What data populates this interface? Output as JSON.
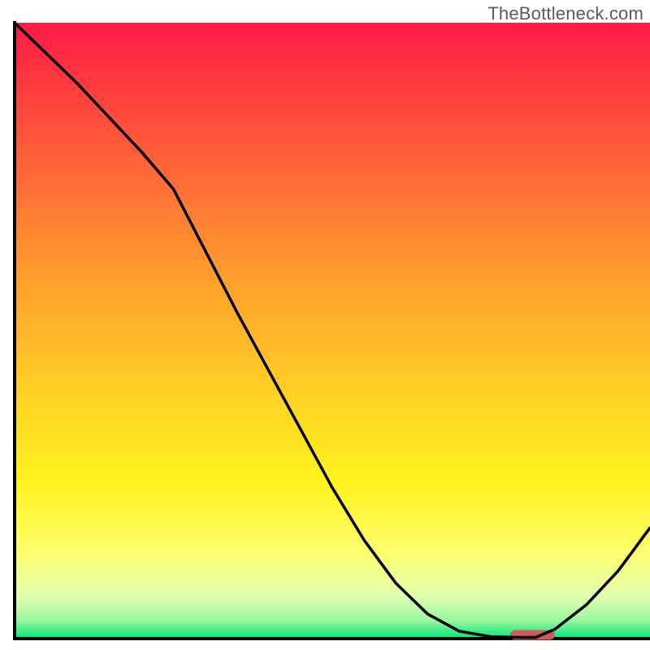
{
  "attribution": "TheBottleneck.com",
  "chart_data": {
    "type": "line",
    "title": "",
    "xlabel": "",
    "ylabel": "",
    "xlim": [
      0,
      100
    ],
    "ylim": [
      0,
      100
    ],
    "x": [
      0,
      5,
      10,
      15,
      20,
      25,
      30,
      35,
      40,
      45,
      50,
      55,
      60,
      65,
      70,
      75,
      80,
      82,
      85,
      90,
      95,
      100
    ],
    "values": [
      100,
      95,
      90,
      84.5,
      79,
      73,
      63,
      53,
      43.5,
      34,
      24.5,
      16,
      9,
      4,
      1.2,
      0.3,
      0.2,
      0.2,
      1.5,
      5.5,
      11,
      18
    ],
    "green_band_y": [
      0,
      2.5
    ],
    "marker": {
      "x_start": 78,
      "x_end": 85,
      "y": 0.6
    }
  },
  "colors": {
    "gradient_stops": [
      {
        "offset": 0.0,
        "color": "#ff1a45"
      },
      {
        "offset": 0.2,
        "color": "#ff5a3a"
      },
      {
        "offset": 0.4,
        "color": "#ff9a2e"
      },
      {
        "offset": 0.6,
        "color": "#ffd024"
      },
      {
        "offset": 0.75,
        "color": "#fff31f"
      },
      {
        "offset": 0.86,
        "color": "#fdff6d"
      },
      {
        "offset": 0.93,
        "color": "#e2ffb0"
      },
      {
        "offset": 0.97,
        "color": "#9cf7a0"
      },
      {
        "offset": 1.0,
        "color": "#00e676"
      }
    ],
    "line": "#000000",
    "axis": "#000000",
    "marker": "#d15a5a"
  }
}
